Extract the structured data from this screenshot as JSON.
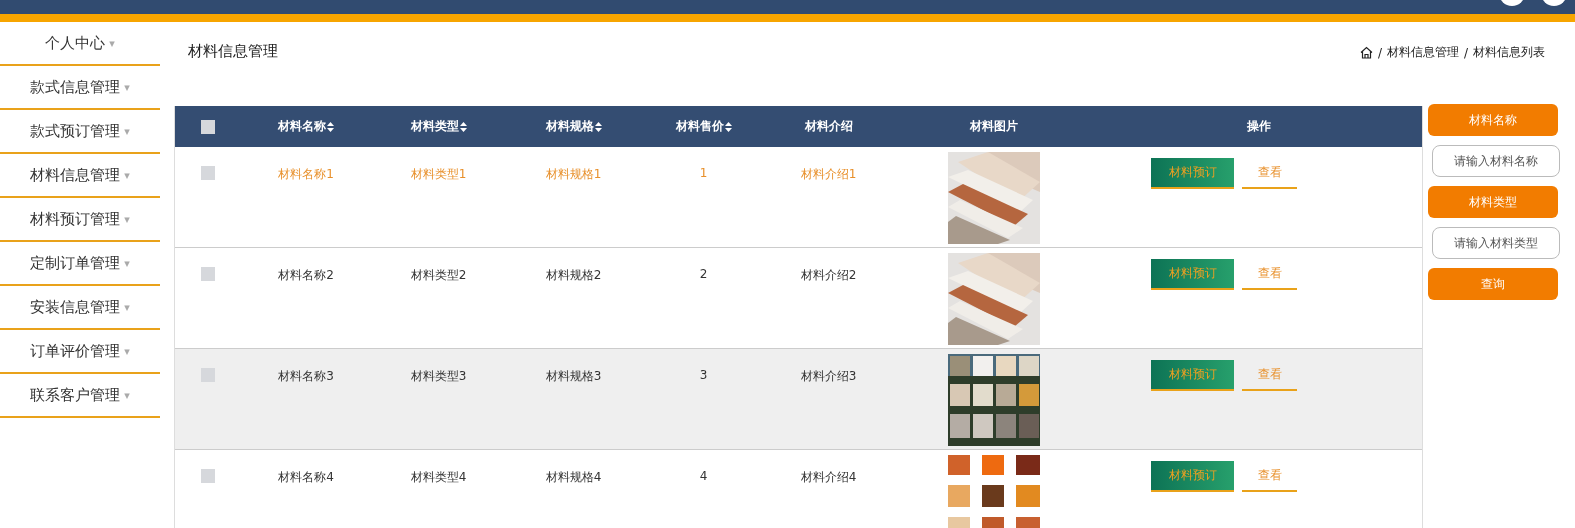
{
  "sidebar": {
    "items": [
      {
        "label": "个人中心",
        "caret": "▾"
      },
      {
        "label": "款式信息管理",
        "caret": "▾"
      },
      {
        "label": "款式预订管理",
        "caret": "▾"
      },
      {
        "label": "材料信息管理",
        "caret": "▾"
      },
      {
        "label": "材料预订管理",
        "caret": "▾"
      },
      {
        "label": "定制订单管理",
        "caret": "▾"
      },
      {
        "label": "安装信息管理",
        "caret": "▾"
      },
      {
        "label": "订单评价管理",
        "caret": "▾"
      },
      {
        "label": "联系客户管理",
        "caret": "▾"
      }
    ]
  },
  "page_title": "材料信息管理",
  "breadcrumb": {
    "separator": "/",
    "items": [
      "材料信息管理",
      "材料信息列表"
    ]
  },
  "table": {
    "columns": [
      {
        "label": "材料名称",
        "sortable": true
      },
      {
        "label": "材料类型",
        "sortable": true
      },
      {
        "label": "材料规格",
        "sortable": true
      },
      {
        "label": "材料售价",
        "sortable": true
      },
      {
        "label": "材料介绍",
        "sortable": false
      },
      {
        "label": "材料图片",
        "sortable": false
      },
      {
        "label": "操作",
        "sortable": false
      }
    ],
    "select_all_checked": false,
    "rows": [
      {
        "highlighted": true,
        "shaded": false,
        "checked": false,
        "cells": [
          "材料名称1",
          "材料类型1",
          "材料规格1",
          "1",
          "材料介绍1"
        ],
        "picture": {
          "kind": "panels"
        },
        "actions": [
          "材料预订",
          "查看"
        ]
      },
      {
        "highlighted": false,
        "shaded": false,
        "checked": false,
        "cells": [
          "材料名称2",
          "材料类型2",
          "材料规格2",
          "2",
          "材料介绍2"
        ],
        "picture": {
          "kind": "panels"
        },
        "actions": [
          "材料预订",
          "查看"
        ]
      },
      {
        "highlighted": false,
        "shaded": true,
        "checked": false,
        "cells": [
          "材料名称3",
          "材料类型3",
          "材料规格3",
          "3",
          "材料介绍3"
        ],
        "picture": {
          "kind": "stone"
        },
        "actions": [
          "材料预订",
          "查看"
        ]
      },
      {
        "highlighted": false,
        "shaded": false,
        "checked": false,
        "cells": [
          "材料名称4",
          "材料类型4",
          "材料规格4",
          "4",
          "材料介绍4"
        ],
        "picture": {
          "kind": "wood"
        },
        "actions": [
          "材料预订",
          "查看"
        ]
      }
    ]
  },
  "search": {
    "fields": [
      {
        "label": "材料名称",
        "placeholder": "请输入材料名称"
      },
      {
        "label": "材料类型",
        "placeholder": "请输入材料类型"
      }
    ],
    "button": "查询"
  }
}
